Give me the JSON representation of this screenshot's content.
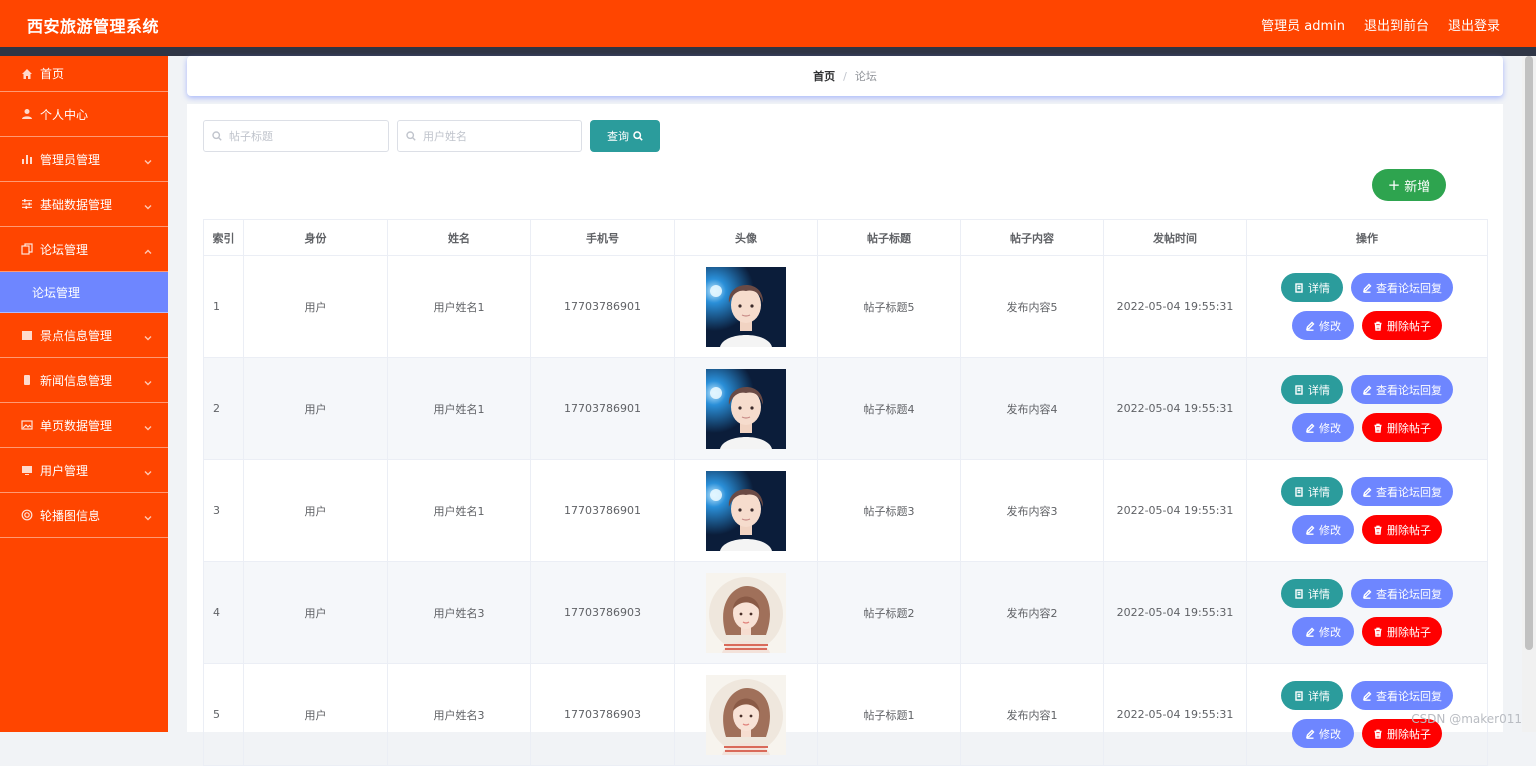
{
  "app": {
    "title": "西安旅游管理系统"
  },
  "topnav": {
    "admin": "管理员 admin",
    "to_front": "退出到前台",
    "logout": "退出登录"
  },
  "sidebar": {
    "items": [
      {
        "label": "首页"
      },
      {
        "label": "个人中心"
      },
      {
        "label": "管理员管理"
      },
      {
        "label": "基础数据管理"
      },
      {
        "label": "论坛管理"
      },
      {
        "label": "景点信息管理"
      },
      {
        "label": "新闻信息管理"
      },
      {
        "label": "单页数据管理"
      },
      {
        "label": "用户管理"
      },
      {
        "label": "轮播图信息"
      }
    ],
    "sub_item": "论坛管理"
  },
  "breadcrumb": {
    "home": "首页",
    "sep": "/",
    "current": "论坛"
  },
  "search": {
    "title_placeholder": "帖子标题",
    "name_placeholder": "用户姓名",
    "query_label": "查询"
  },
  "add_button": "新增",
  "table": {
    "headers": [
      "索引",
      "身份",
      "姓名",
      "手机号",
      "头像",
      "帖子标题",
      "帖子内容",
      "发帖时间",
      "操作"
    ],
    "rows": [
      {
        "index": "1",
        "role": "用户",
        "name": "用户姓名1",
        "phone": "17703786901",
        "avatar": "male",
        "title": "帖子标题5",
        "content": "发布内容5",
        "time": "2022-05-04 19:55:31"
      },
      {
        "index": "2",
        "role": "用户",
        "name": "用户姓名1",
        "phone": "17703786901",
        "avatar": "male",
        "title": "帖子标题4",
        "content": "发布内容4",
        "time": "2022-05-04 19:55:31"
      },
      {
        "index": "3",
        "role": "用户",
        "name": "用户姓名1",
        "phone": "17703786901",
        "avatar": "male",
        "title": "帖子标题3",
        "content": "发布内容3",
        "time": "2022-05-04 19:55:31"
      },
      {
        "index": "4",
        "role": "用户",
        "name": "用户姓名3",
        "phone": "17703786903",
        "avatar": "female",
        "title": "帖子标题2",
        "content": "发布内容2",
        "time": "2022-05-04 19:55:31"
      },
      {
        "index": "5",
        "role": "用户",
        "name": "用户姓名3",
        "phone": "17703786903",
        "avatar": "female",
        "title": "帖子标题1",
        "content": "发布内容1",
        "time": "2022-05-04 19:55:31"
      }
    ],
    "actions": {
      "detail": "详情",
      "reply": "查看论坛回复",
      "edit": "修改",
      "delete": "删除帖子"
    }
  },
  "watermark": "CSDN @maker011",
  "colors": {
    "primary": "#ff4500",
    "teal": "#2b9c9c",
    "periwinkle": "#6e86ff",
    "danger": "#ff0000",
    "success": "#2ea44f"
  }
}
